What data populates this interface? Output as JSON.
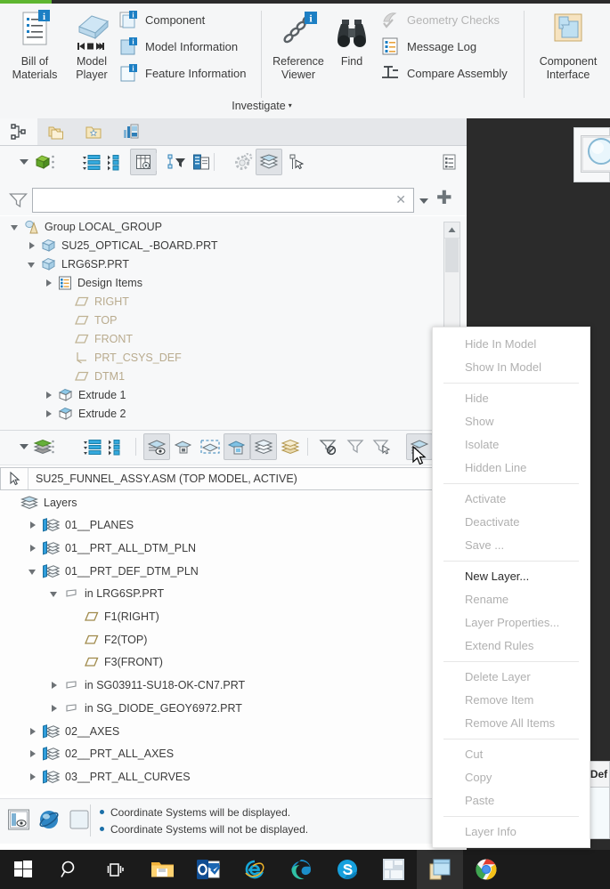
{
  "ribbon": {
    "group_label": "Investigate",
    "dropdown_arrow": "▾",
    "big_buttons": [
      {
        "name": "bill-of-materials",
        "line1": "Bill of",
        "line2": "Materials",
        "icon": "bom-icon"
      },
      {
        "name": "model-player",
        "line1": "Model",
        "line2": "Player",
        "icon": "model-player-icon"
      },
      {
        "name": "reference-viewer",
        "line1": "Reference",
        "line2": "Viewer",
        "icon": "reference-viewer-icon"
      },
      {
        "name": "find",
        "line1": "Find",
        "line2": "",
        "icon": "binoculars-icon"
      },
      {
        "name": "component-interface",
        "line1": "Component",
        "line2": "Interface",
        "icon": "component-interface-icon"
      }
    ],
    "small_items": [
      {
        "name": "component",
        "label": "Component",
        "icon": "component-icon",
        "disabled": false
      },
      {
        "name": "model-information",
        "label": "Model Information",
        "icon": "model-information-icon",
        "disabled": false
      },
      {
        "name": "feature-information",
        "label": "Feature Information",
        "icon": "feature-information-icon",
        "disabled": false
      },
      {
        "name": "geometry-checks",
        "label": "Geometry Checks",
        "icon": "geometry-checks-icon",
        "disabled": true
      },
      {
        "name": "message-log",
        "label": "Message Log",
        "icon": "message-log-icon",
        "disabled": false
      },
      {
        "name": "compare-assembly",
        "label": "Compare Assembly",
        "icon": "compare-assembly-icon",
        "disabled": false
      }
    ]
  },
  "navigator": {
    "tabs": [
      {
        "name": "tab-model-tree",
        "icon": "model-tree-icon",
        "active": true
      },
      {
        "name": "tab-folder-browser",
        "icon": "folders-icon",
        "active": false
      },
      {
        "name": "tab-favorites",
        "icon": "favorites-folder-icon",
        "active": false
      },
      {
        "name": "tab-layers-view",
        "icon": "layers-chart-icon",
        "active": false
      }
    ],
    "toolbar": [
      {
        "name": "tree-scope-dropdown",
        "icon": "chevron-down-icon"
      },
      {
        "name": "tree-model-cube",
        "icon": "green-cube-icon"
      },
      {
        "name": "tree-overflow",
        "icon": "vertical-dots-icon"
      },
      {
        "name": "expand-all",
        "icon": "expand-list-icon"
      },
      {
        "name": "collapse-all",
        "icon": "collapse-list-icon"
      },
      {
        "name": "tree-columns",
        "icon": "tree-columns-icon",
        "selected": true
      },
      {
        "name": "tree-filter",
        "icon": "tree-filter-icon"
      },
      {
        "name": "tree-copy",
        "icon": "tree-copy-icon"
      },
      {
        "name": "tree-settings",
        "icon": "gear-icon"
      },
      {
        "name": "layer-tree-toggle",
        "icon": "layers-icon",
        "selected": true
      },
      {
        "name": "tree-flag",
        "icon": "flag-pointer-icon"
      },
      {
        "name": "tree-report",
        "icon": "report-icon"
      }
    ],
    "filter": {
      "icon": "funnel-icon",
      "value": "",
      "placeholder": "",
      "clear_label": "✕",
      "dropdown_icon": "chevron-down-icon",
      "add_label": "✚"
    },
    "tree": [
      {
        "name": "tree-item-group-local-group",
        "label": "Group LOCAL_GROUP",
        "indent": 0,
        "toggle": "down",
        "icon": "group-icon",
        "dim": false
      },
      {
        "name": "tree-item-su25-optical-board",
        "label": "SU25_OPTICAL_-BOARD.PRT",
        "indent": 1,
        "toggle": "right",
        "icon": "part-icon",
        "dim": false
      },
      {
        "name": "tree-item-lrg6sp",
        "label": "LRG6SP.PRT",
        "indent": 1,
        "toggle": "down",
        "icon": "part-icon",
        "dim": false
      },
      {
        "name": "tree-item-design-items",
        "label": "Design Items",
        "indent": 2,
        "toggle": "right",
        "icon": "design-items-icon",
        "dim": false
      },
      {
        "name": "tree-item-right",
        "label": "RIGHT",
        "indent": 3,
        "toggle": "none",
        "icon": "datum-plane-icon",
        "dim": true
      },
      {
        "name": "tree-item-top",
        "label": "TOP",
        "indent": 3,
        "toggle": "none",
        "icon": "datum-plane-icon",
        "dim": true
      },
      {
        "name": "tree-item-front",
        "label": "FRONT",
        "indent": 3,
        "toggle": "none",
        "icon": "datum-plane-icon",
        "dim": true
      },
      {
        "name": "tree-item-prt-csys-def",
        "label": "PRT_CSYS_DEF",
        "indent": 3,
        "toggle": "none",
        "icon": "csys-icon",
        "dim": true
      },
      {
        "name": "tree-item-dtm1",
        "label": "DTM1",
        "indent": 3,
        "toggle": "none",
        "icon": "datum-plane-icon",
        "dim": true
      },
      {
        "name": "tree-item-extrude-1",
        "label": "Extrude 1",
        "indent": 2,
        "toggle": "right",
        "icon": "extrude-icon",
        "dim": false
      },
      {
        "name": "tree-item-extrude-2",
        "label": "Extrude 2",
        "indent": 2,
        "toggle": "right",
        "icon": "extrude-icon",
        "dim": false
      }
    ]
  },
  "layers_panel": {
    "toolbar": [
      {
        "name": "layer-scope-dropdown",
        "icon": "chevron-down-icon"
      },
      {
        "name": "layer-stack",
        "icon": "green-layers-icon"
      },
      {
        "name": "layer-overflow",
        "icon": "vertical-dots-icon"
      },
      {
        "name": "layer-expand-all",
        "icon": "expand-list-icon"
      },
      {
        "name": "layer-collapse-all",
        "icon": "collapse-list-icon"
      },
      {
        "name": "layer-display-status",
        "icon": "layer-eye-icon",
        "selected": true
      },
      {
        "name": "layer-hide-item",
        "icon": "layer-hide-icon"
      },
      {
        "name": "layer-new-layer",
        "icon": "layer-new-icon"
      },
      {
        "name": "layer-isolate",
        "icon": "layer-isolate-icon",
        "selected": true
      },
      {
        "name": "layer-show-all",
        "icon": "layer-show-icon",
        "selected": true
      },
      {
        "name": "layer-save-status",
        "icon": "layer-save-icon"
      },
      {
        "name": "layer-filter-none",
        "icon": "filter-none-icon"
      },
      {
        "name": "layer-filter-clear",
        "icon": "filter-clear-icon"
      },
      {
        "name": "layer-filter-select",
        "icon": "filter-select-icon"
      },
      {
        "name": "layer-properties",
        "icon": "layer-properties-icon",
        "selected": true
      }
    ],
    "model_selector": {
      "icon": "select-arrow-icon",
      "value": "SU25_FUNNEL_ASSY.ASM (TOP MODEL, ACTIVE)"
    },
    "tree": [
      {
        "name": "layer-root-layers",
        "label": "Layers",
        "indent": 0,
        "toggle": "none",
        "icon": "layers-icon",
        "color": "normal"
      },
      {
        "name": "layer-01-planes",
        "label": "01__PLANES",
        "indent": 1,
        "toggle": "right",
        "icon": "layer-icon",
        "color": "normal"
      },
      {
        "name": "layer-01-prt-all-dtm-pln",
        "label": "01__PRT_ALL_DTM_PLN",
        "indent": 1,
        "toggle": "right",
        "icon": "layer-icon",
        "color": "normal"
      },
      {
        "name": "layer-01-prt-def-dtm-pln",
        "label": "01__PRT_DEF_DTM_PLN",
        "indent": 1,
        "toggle": "down",
        "icon": "layer-icon",
        "color": "normal"
      },
      {
        "name": "layer-in-lrg6sp",
        "label": "in LRG6SP.PRT",
        "indent": 2,
        "toggle": "down",
        "icon": "sublayer-icon",
        "color": "normal"
      },
      {
        "name": "layer-f1-right",
        "label": "F1(RIGHT)",
        "indent": 3,
        "toggle": "none",
        "icon": "datum-plane-icon",
        "color": "gold"
      },
      {
        "name": "layer-f2-top",
        "label": "F2(TOP)",
        "indent": 3,
        "toggle": "none",
        "icon": "datum-plane-icon",
        "color": "gold"
      },
      {
        "name": "layer-f3-front",
        "label": "F3(FRONT)",
        "indent": 3,
        "toggle": "none",
        "icon": "datum-plane-icon",
        "color": "gold"
      },
      {
        "name": "layer-in-sg03911",
        "label": "in SG03911-SU18-OK-CN7.PRT",
        "indent": 2,
        "toggle": "right",
        "icon": "sublayer-icon",
        "color": "normal"
      },
      {
        "name": "layer-in-sg-diode",
        "label": "in SG_DIODE_GEOY6972.PRT",
        "indent": 2,
        "toggle": "right",
        "icon": "sublayer-icon",
        "color": "normal"
      },
      {
        "name": "layer-02-axes",
        "label": "02__AXES",
        "indent": 1,
        "toggle": "right",
        "icon": "layer-icon",
        "color": "normal"
      },
      {
        "name": "layer-02-prt-all-axes",
        "label": "02__PRT_ALL_AXES",
        "indent": 1,
        "toggle": "right",
        "icon": "layer-icon",
        "color": "normal"
      },
      {
        "name": "layer-03-prt-all-curves",
        "label": "03__PRT_ALL_CURVES",
        "indent": 1,
        "toggle": "right",
        "icon": "layer-icon",
        "color": "normal"
      }
    ]
  },
  "status_bar": {
    "icons": [
      {
        "name": "status-display-panel-icon"
      },
      {
        "name": "status-spin-center-icon"
      },
      {
        "name": "status-blank-icon"
      }
    ],
    "messages": [
      "Coordinate Systems will be displayed.",
      "Coordinate Systems will not be displayed."
    ]
  },
  "context_menu": {
    "items": [
      {
        "name": "ctx-hide-in-model",
        "label": "Hide In Model",
        "enabled": false,
        "separator_after": false
      },
      {
        "name": "ctx-show-in-model",
        "label": "Show In Model",
        "enabled": false,
        "separator_after": true
      },
      {
        "name": "ctx-hide",
        "label": "Hide",
        "enabled": false,
        "separator_after": false
      },
      {
        "name": "ctx-show",
        "label": "Show",
        "enabled": false,
        "separator_after": false
      },
      {
        "name": "ctx-isolate",
        "label": "Isolate",
        "enabled": false,
        "separator_after": false
      },
      {
        "name": "ctx-hidden-line",
        "label": "Hidden Line",
        "enabled": false,
        "separator_after": true
      },
      {
        "name": "ctx-activate",
        "label": "Activate",
        "enabled": false,
        "separator_after": false
      },
      {
        "name": "ctx-deactivate",
        "label": "Deactivate",
        "enabled": false,
        "separator_after": false
      },
      {
        "name": "ctx-save",
        "label": "Save ...",
        "enabled": false,
        "separator_after": true
      },
      {
        "name": "ctx-new-layer",
        "label": "New Layer...",
        "enabled": true,
        "separator_after": false
      },
      {
        "name": "ctx-rename",
        "label": "Rename",
        "enabled": false,
        "separator_after": false
      },
      {
        "name": "ctx-layer-properties",
        "label": "Layer Properties...",
        "enabled": false,
        "separator_after": false
      },
      {
        "name": "ctx-extend-rules",
        "label": "Extend Rules",
        "enabled": false,
        "separator_after": true
      },
      {
        "name": "ctx-delete-layer",
        "label": "Delete Layer",
        "enabled": false,
        "separator_after": false
      },
      {
        "name": "ctx-remove-item",
        "label": "Remove Item",
        "enabled": false,
        "separator_after": false
      },
      {
        "name": "ctx-remove-all-items",
        "label": "Remove All Items",
        "enabled": false,
        "separator_after": true
      },
      {
        "name": "ctx-cut",
        "label": "Cut",
        "enabled": false,
        "separator_after": false
      },
      {
        "name": "ctx-copy",
        "label": "Copy",
        "enabled": false,
        "separator_after": false
      },
      {
        "name": "ctx-paste",
        "label": "Paste",
        "enabled": false,
        "separator_after": true
      },
      {
        "name": "ctx-layer-info",
        "label": "Layer Info",
        "enabled": false,
        "separator_after": false
      }
    ]
  },
  "right_panel": {
    "tab_label": "Def"
  },
  "taskbar": {
    "items": [
      {
        "name": "start-button",
        "icon": "windows-logo-icon"
      },
      {
        "name": "search-button",
        "icon": "search-icon"
      },
      {
        "name": "task-view-button",
        "icon": "task-view-icon"
      },
      {
        "name": "file-explorer-button",
        "icon": "file-explorer-icon"
      },
      {
        "name": "outlook-button",
        "icon": "outlook-icon"
      },
      {
        "name": "internet-explorer-button",
        "icon": "internet-explorer-icon"
      },
      {
        "name": "edge-button",
        "icon": "edge-icon"
      },
      {
        "name": "skype-button",
        "icon": "skype-icon"
      },
      {
        "name": "microsoft-store-button",
        "icon": "microsoft-store-icon"
      },
      {
        "name": "creo-button",
        "icon": "creo-icon",
        "active": true
      },
      {
        "name": "chrome-button",
        "icon": "chrome-icon"
      }
    ]
  }
}
